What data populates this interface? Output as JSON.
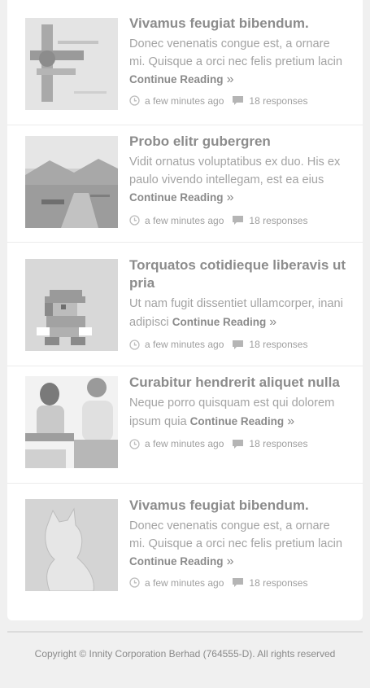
{
  "posts": [
    {
      "title": "Vivamus feugiat bibendum.",
      "excerpt": "Donec venenatis congue est, a ornare mi. Quisque a orci nec felis pretium lacin",
      "more_label": "Continue Reading",
      "more_arrow": "»",
      "time": "a few minutes ago",
      "responses": "18 responses",
      "thumb_icon": "airplane-photo-icon"
    },
    {
      "title": "Probo elitr gubergren",
      "excerpt": "Vidit ornatus voluptatibus ex duo. His ex paulo vivendo intellegam, est ea eius",
      "more_label": "Continue Reading",
      "more_arrow": "»",
      "time": "a few minutes ago",
      "responses": "18 responses",
      "thumb_icon": "lake-pier-photo-icon"
    },
    {
      "title": "Torquatos cotidieque liberavis ut pria",
      "excerpt": "Ut nam fugit dissentiet ullamcorper, inani adipisci",
      "more_label": "Continue Reading",
      "more_arrow": "»",
      "time": "a few minutes ago",
      "responses": "18 responses",
      "thumb_icon": "pixel-character-icon"
    },
    {
      "title": "Curabitur hendrerit aliquet nulla",
      "excerpt": "Neque porro quisquam est qui dolorem ipsum quia",
      "more_label": "Continue Reading",
      "more_arrow": "»",
      "time": "a few minutes ago",
      "responses": "18 responses",
      "thumb_icon": "fitness-women-photo-icon"
    },
    {
      "title": "Vivamus feugiat bibendum.",
      "excerpt": "Donec venenatis congue est, a ornare mi. Quisque a orci nec felis pretium lacin",
      "more_label": "Continue Reading",
      "more_arrow": "»",
      "time": "a few minutes ago",
      "responses": "18 responses",
      "thumb_icon": "cat-sketch-icon"
    }
  ],
  "footer": {
    "copyright": "Copyright © Innity Corporation Berhad (764555-D). All rights reserved"
  },
  "colors": {
    "background": "#f0f0f0",
    "card": "#ffffff",
    "title": "#8c8c8c",
    "text": "#a3a3a3"
  }
}
